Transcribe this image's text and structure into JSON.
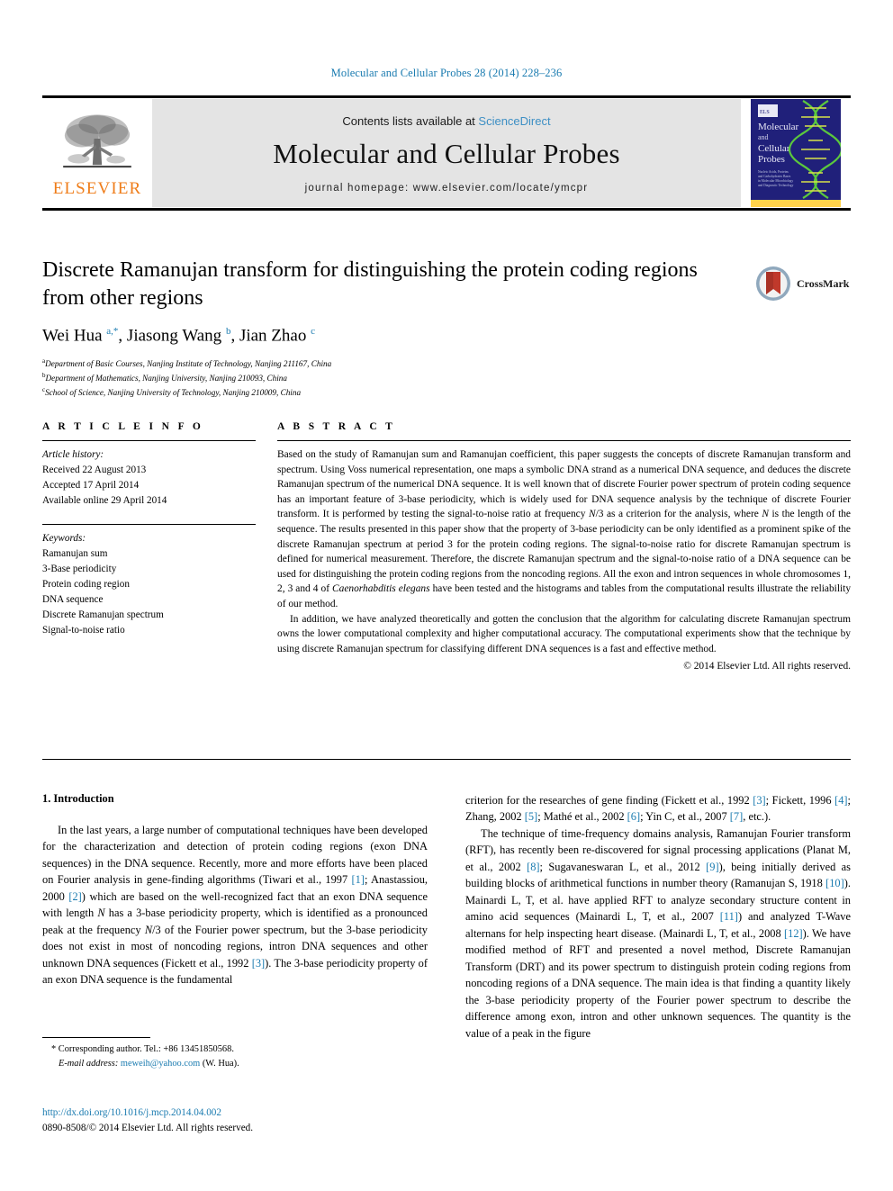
{
  "running_head": "Molecular and Cellular Probes 28 (2014) 228–236",
  "masthead": {
    "publisher_name": "ELSEVIER",
    "contents_prefix": "Contents lists available at ",
    "contents_link": "ScienceDirect",
    "journal_title": "Molecular and Cellular Probes",
    "homepage_line": "journal homepage: www.elsevier.com/locate/ymcpr",
    "cover_title_1": "Molecular",
    "cover_title_2": "and",
    "cover_title_3": "Cellular",
    "cover_title_4": "Probes"
  },
  "article": {
    "title": "Discrete Ramanujan transform for distinguishing the protein coding regions from other regions",
    "authors_html": "Wei Hua <sup>a,*</sup>, Jiasong Wang <sup>b</sup>, Jian Zhao <sup>c</sup>",
    "affiliations": [
      {
        "marker": "a",
        "text": "Department of Basic Courses, Nanjing Institute of Technology, Nanjing 211167, China"
      },
      {
        "marker": "b",
        "text": "Department of Mathematics, Nanjing University, Nanjing 210093, China"
      },
      {
        "marker": "c",
        "text": "School of Science, Nanjing University of Technology, Nanjing 210009, China"
      }
    ],
    "crossmark_label": "CrossMark"
  },
  "article_info": {
    "heading": "A R T I C L E   I N F O",
    "history_label": "Article history:",
    "history": [
      "Received 22 August 2013",
      "Accepted 17 April 2014",
      "Available online 29 April 2014"
    ],
    "keywords_label": "Keywords:",
    "keywords": [
      "Ramanujan sum",
      "3-Base periodicity",
      "Protein coding region",
      "DNA sequence",
      "Discrete Ramanujan spectrum",
      "Signal-to-noise ratio"
    ]
  },
  "abstract": {
    "heading": "A B S T R A C T",
    "paragraph_1_html": "Based on the study of Ramanujan sum and Ramanujan coefficient, this paper suggests the concepts of discrete Ramanujan transform and spectrum. Using Voss numerical representation, one maps a symbolic DNA strand as a numerical DNA sequence, and deduces the discrete Ramanujan spectrum of the numerical DNA sequence. It is well known that of discrete Fourier power spectrum of protein coding sequence has an important feature of 3-base periodicity, which is widely used for DNA sequence analysis by the technique of discrete Fourier transform. It is performed by testing the signal-to-noise ratio at frequency <i>N</i>/3 as a criterion for the analysis, where <i>N</i> is the length of the sequence. The results presented in this paper show that the property of 3-base periodicity can be only identified as a prominent spike of the discrete Ramanujan spectrum at period 3 for the protein coding regions. The signal-to-noise ratio for discrete Ramanujan spectrum is defined for numerical measurement. Therefore, the discrete Ramanujan spectrum and the signal-to-noise ratio of a DNA sequence can be used for distinguishing the protein coding regions from the noncoding regions. All the exon and intron sequences in whole chromosomes 1, 2, 3 and 4 of <i>Caenorhabditis elegans</i> have been tested and the histograms and tables from the computational results illustrate the reliability of our method.",
    "paragraph_2_html": "In addition, we have analyzed theoretically and gotten the conclusion that the algorithm for calculating discrete Ramanujan spectrum owns the lower computational complexity and higher computational accuracy. The computational experiments show that the technique by using discrete Ramanujan spectrum for classifying different DNA sequences is a fast and effective method.",
    "copyright": "© 2014 Elsevier Ltd. All rights reserved."
  },
  "introduction": {
    "heading": "1. Introduction",
    "left_column_html": "In the last years, a large number of computational techniques have been developed for the characterization and detection of protein coding regions (exon DNA sequences) in the DNA sequence. Recently, more and more efforts have been placed on Fourier analysis in gene-finding algorithms (Tiwari et al., 1997 <span class=\"ref\">[1]</span>; Anastassiou, 2000 <span class=\"ref\">[2]</span>) which are based on the well-recognized fact that an exon DNA sequence with length <i>N</i> has a 3-base periodicity property, which is identified as a pronounced peak at the frequency <i>N</i>/3 of the Fourier power spectrum, but the 3-base periodicity does not exist in most of noncoding regions, intron DNA sequences and other unknown DNA sequences (Fickett et al., 1992 <span class=\"ref\">[3]</span>). The 3-base periodicity property of an exon DNA sequence is the fundamental",
    "right_column_para1_html": "criterion for the researches of gene finding (Fickett et al., 1992 <span class=\"ref\">[3]</span>; Fickett, 1996 <span class=\"ref\">[4]</span>; Zhang, 2002 <span class=\"ref\">[5]</span>; Mathé et al., 2002 <span class=\"ref\">[6]</span>; Yin C, et al., 2007 <span class=\"ref\">[7]</span>, etc.).",
    "right_column_para2_html": "The technique of time-frequency domains analysis, Ramanujan Fourier transform (RFT), has recently been re-discovered for signal processing applications (Planat M, et al., 2002 <span class=\"ref\">[8]</span>; Sugavaneswaran L, et al., 2012 <span class=\"ref\">[9]</span>), being initially derived as building blocks of arithmetical functions in number theory (Ramanujan S, 1918 <span class=\"ref\">[10]</span>). Mainardi L, T, et al. have applied RFT to analyze secondary structure content in amino acid sequences (Mainardi L, T, et al., 2007 <span class=\"ref\">[11]</span>) and analyzed T-Wave alternans for help inspecting heart disease. (Mainardi L, T, et al., 2008 <span class=\"ref\">[12]</span>). We have modified method of RFT and presented a novel method, Discrete Ramanujan Transform (DRT) and its power spectrum to distinguish protein coding regions from noncoding regions of a DNA sequence. The main idea is that finding a quantity likely the 3-base periodicity property of the Fourier power spectrum to describe the difference among exon, intron and other unknown sequences. The quantity is the value of a peak in the figure"
  },
  "footnote": {
    "corresponding_html": "* Corresponding author. Tel.: +86 13451850568.",
    "email_label": "E-mail address:",
    "email": "meweih@yahoo.com",
    "email_suffix": "(W. Hua)."
  },
  "footer": {
    "doi": "http://dx.doi.org/10.1016/j.mcp.2014.04.002",
    "issn_line": "0890-8508/© 2014 Elsevier Ltd. All rights reserved."
  },
  "colors": {
    "link": "#1a7bb0",
    "elsevier_orange": "#ef7d1a",
    "sciencedirect": "#3d8fc4",
    "cover_blue": "#20207a"
  }
}
